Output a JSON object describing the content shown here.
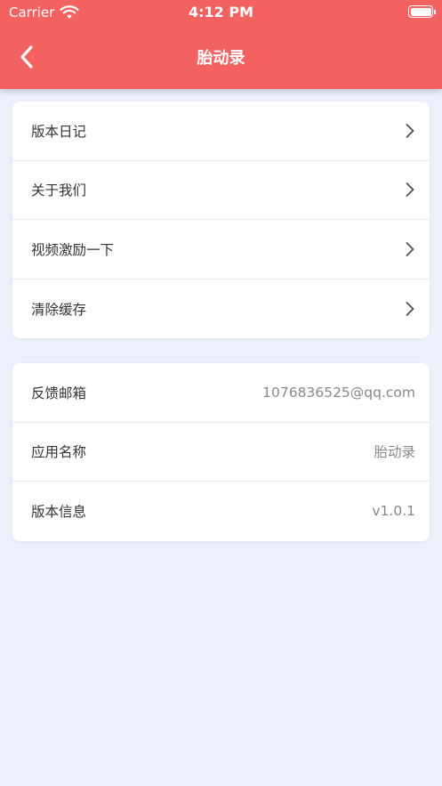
{
  "status_bar": {
    "carrier": "Carrier",
    "time": "4:12 PM"
  },
  "nav": {
    "title": "胎动录"
  },
  "menu": {
    "items": [
      {
        "label": "版本日记"
      },
      {
        "label": "关于我们"
      },
      {
        "label": "视频激励一下"
      },
      {
        "label": "清除缓存"
      }
    ]
  },
  "info": {
    "rows": [
      {
        "label": "反馈邮箱",
        "value": "1076836525@qq.com"
      },
      {
        "label": "应用名称",
        "value": "胎动录"
      },
      {
        "label": "版本信息",
        "value": "v1.0.1"
      }
    ]
  },
  "colors": {
    "header": "#f46161",
    "background": "#ebf0fb"
  }
}
